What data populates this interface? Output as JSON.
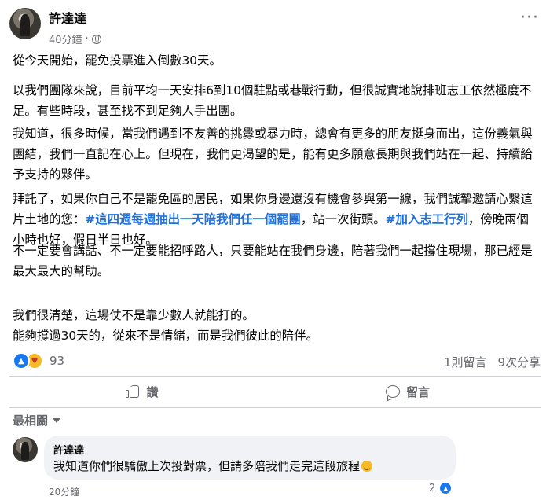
{
  "post": {
    "author": "許達達",
    "time": "40分鐘",
    "separator": "·",
    "more_glyph": "···",
    "paragraphs": {
      "p1": "從今天開始，罷免投票進入倒數30天。",
      "p2": "以我們團隊來說，目前平均一天安排6到10個駐點或巷戰行動，但很誠實地說排班志工依然極度不足。有些時段，甚至找不到足夠人手出團。",
      "p3": "我知道，很多時候，當我們遇到不友善的挑釁或暴力時，總會有更多的朋友挺身而出，這份義氣與團結，我們一直記在心上。但現在，我們更渴望的是，能有更多願意長期與我們站在一起、持續給予支持的夥伴。",
      "p4_a": "拜託了，如果你自己不是罷免區的居民，如果你身邊還沒有機會參與第一線，我們誠摯邀請心繫這片土地的您：",
      "p4_tag1": "#這四週每週抽出一天陪我們任一個罷團",
      "p4_b": "，站一次街頭。",
      "p4_tag2": "#加入志工行列",
      "p4_c": "，傍晚兩個小時也好，假日半日也好。",
      "p5": "不一定要會講話、不一定要能招呼路人，只要能站在我們身邊，陪著我們一起撐住現場，那已經是最大最大的幫助。",
      "p6_line1": "我們很清楚，這場仗不是靠少數人就能打的。",
      "p6_line2": "能夠撐過30天的，從來不是情緒，而是我們彼此的陪伴。"
    }
  },
  "stats": {
    "reaction_count": "93",
    "comments": "1則留言",
    "shares": "9次分享"
  },
  "actions": {
    "like_label": "讚",
    "comment_label": "留言"
  },
  "sort": {
    "label": "最相關"
  },
  "comment": {
    "author": "許達達",
    "text": "我知道你們很驕傲上次投對票，但請多陪我們走完這段旅程",
    "time": "20分鐘",
    "reaction_count": "2"
  },
  "colors": {
    "accent": "#1877f2",
    "hashtag": "#216fdb",
    "secondary_text": "#65676b",
    "comment_bg": "#f0f2f5"
  }
}
